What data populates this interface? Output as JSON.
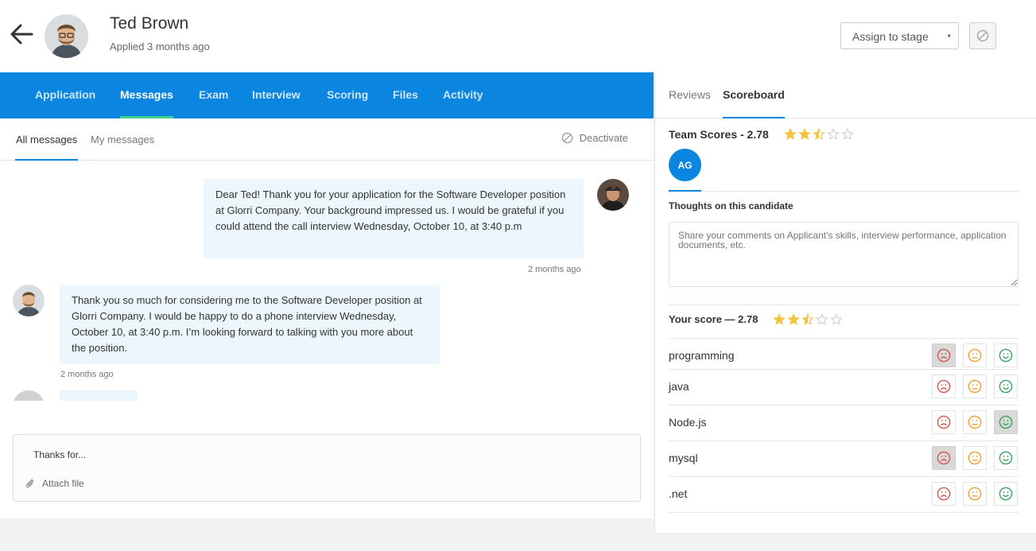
{
  "candidate": {
    "name": "Ted Brown",
    "applied": "Applied 3 months ago"
  },
  "header": {
    "assign_label": "Assign to stage",
    "assign_caret": "▾"
  },
  "tabs": [
    {
      "label": "Application",
      "active": false
    },
    {
      "label": "Messages",
      "active": true
    },
    {
      "label": "Exam",
      "active": false
    },
    {
      "label": "Interview",
      "active": false
    },
    {
      "label": "Scoring",
      "active": false
    },
    {
      "label": "Files",
      "active": false
    },
    {
      "label": "Activity",
      "active": false
    }
  ],
  "subtabs": {
    "all": "All messages",
    "mine": "My messages",
    "deactivate": "Deactivate"
  },
  "messages": [
    {
      "from": "recruiter",
      "text": "Dear Ted! Thank you for your application for the Software Developer position at Glorri Company. Your background impressed us. I would be grateful if you could attend the call interview Wednesday, October 10, at 3:40 p.m",
      "time": "2 months ago"
    },
    {
      "from": "candidate",
      "text": "Thank you so much for considering me to the Software Developer position at Glorri Company. I would be happy to do a phone interview Wednesday, October 10, at 3:40 p.m. I’m looking forward to talking with you more about the position.",
      "time": "2 months ago"
    }
  ],
  "composer": {
    "text": "Thanks for...",
    "attach": "Attach file"
  },
  "right_tabs": {
    "reviews": "Reviews",
    "scoreboard": "Scoreboard"
  },
  "team_scores": {
    "title": "Team Scores - 2.78",
    "rating": 2.5,
    "reviewer_initials": "AG"
  },
  "thoughts": {
    "label": "Thoughts on this candidate",
    "placeholder": "Share your comments on Applicant's skills, interview performance, application documents, etc."
  },
  "your_score": {
    "title": "Your score — 2.78",
    "rating": 2.5
  },
  "skills": [
    {
      "name": "programming",
      "selected": "sad"
    },
    {
      "name": "java",
      "selected": "none"
    },
    {
      "name": "Node.js",
      "selected": "happy"
    },
    {
      "name": "mysql",
      "selected": "sad"
    },
    {
      "name": ".net",
      "selected": "none"
    }
  ],
  "colors": {
    "primary": "#0a86e0",
    "tab_underline": "#3ed28b",
    "star": "#f5c342",
    "sad": "#d9534f",
    "neutral": "#f0a030",
    "happy": "#3aa35d",
    "bubble": "#ecf6fd"
  }
}
